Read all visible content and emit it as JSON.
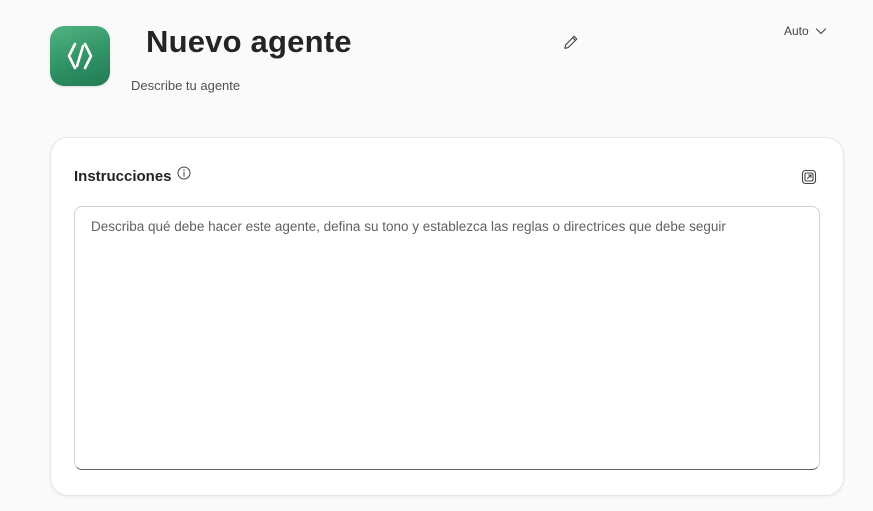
{
  "agent": {
    "name": "Nuevo agente",
    "description": "Describe tu agente",
    "logo_color": "#3fa273",
    "logo_icon": "code-brackets-icon"
  },
  "mode_selector": {
    "value": "Auto",
    "icon": "chevron-down-icon"
  },
  "edit_icon": "pencil-icon",
  "instructions": {
    "title": "Instrucciones",
    "info_icon": "info-icon",
    "expand_icon": "expand-icon",
    "value": "",
    "placeholder": "Describa qué debe hacer este agente, defina su tono y establezca las reglas o directrices que debe seguir"
  }
}
